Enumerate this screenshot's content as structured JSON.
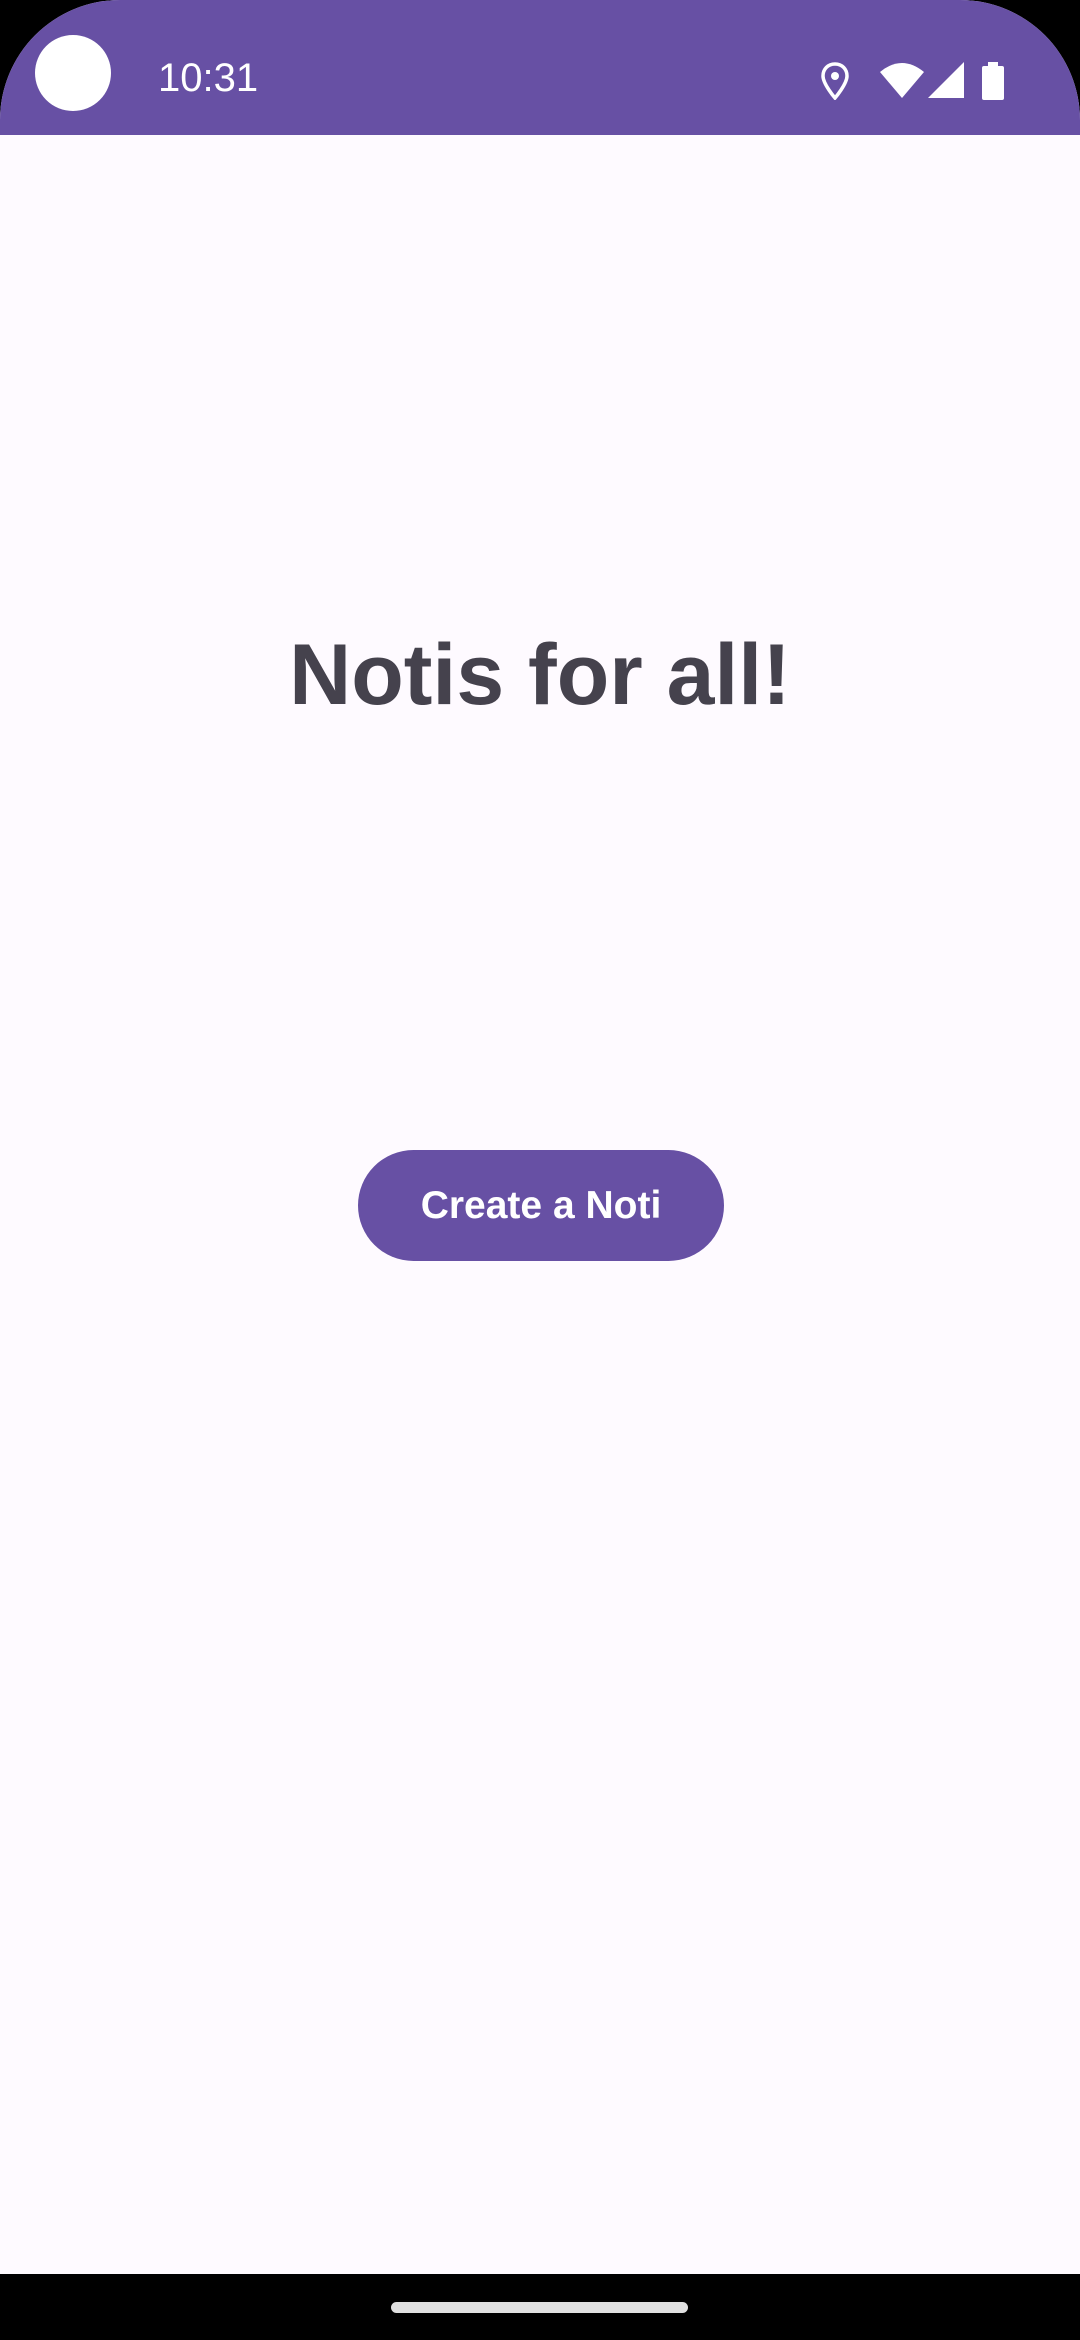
{
  "status_bar": {
    "time": "10:31",
    "background_color": "#6750a4",
    "icons": [
      "location-icon",
      "wifi-icon",
      "cellular-signal-icon",
      "battery-icon"
    ]
  },
  "main": {
    "title": "Notis for all!",
    "title_color": "#45424d",
    "background_color": "#fefaff",
    "create_button_label": "Create a Noti",
    "button_color": "#6750a4"
  },
  "navigation": {
    "gesture_handle": "home-gesture-handle"
  }
}
